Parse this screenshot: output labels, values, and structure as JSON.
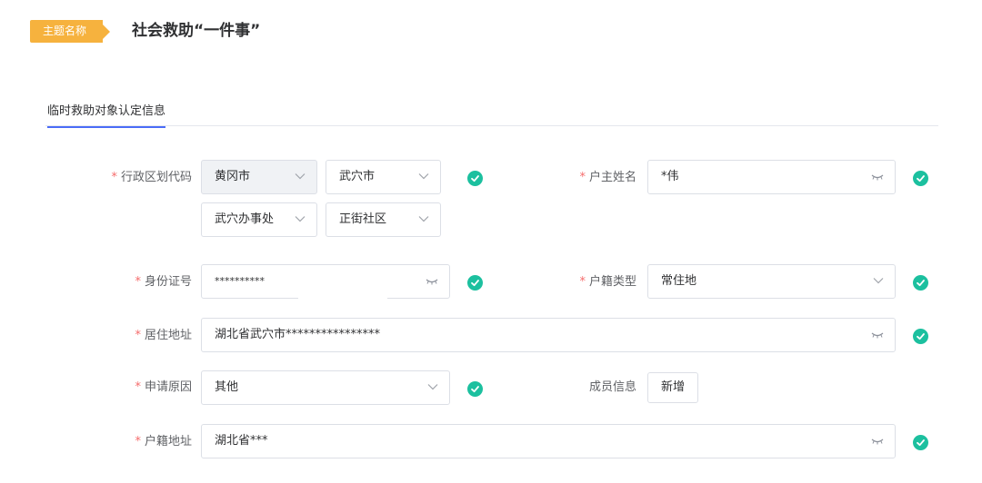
{
  "header": {
    "tag": "主题名称",
    "title": "社会救助“一件事”"
  },
  "tabs": [
    {
      "label": "临时救助对象认定信息"
    }
  ],
  "form": {
    "region": {
      "label": "行政区划代码",
      "city": "黄冈市",
      "county": "武穴市",
      "street": "武穴办事处",
      "community": "正街社区"
    },
    "householder_name": {
      "label": "户主姓名",
      "value": "*伟"
    },
    "id_number": {
      "label": "身份证号",
      "value": "**********"
    },
    "household_type": {
      "label": "户籍类型",
      "value": "常住地"
    },
    "residence_address": {
      "label": "居住地址",
      "value": "湖北省武穴市****************"
    },
    "apply_reason": {
      "label": "申请原因",
      "value": "其他"
    },
    "member_info": {
      "label": "成员信息",
      "add_button": "新增"
    },
    "household_address": {
      "label": "户籍地址",
      "value": "湖北省***"
    }
  },
  "icons": {
    "valid": "check-circle-icon",
    "mask": "eye-closed-icon",
    "dropdown": "chevron-down-icon"
  },
  "colors": {
    "tag": "#f6b23e",
    "tab_active": "#4a6cf7",
    "valid": "#1cc09f",
    "required": "#f56c6c"
  }
}
